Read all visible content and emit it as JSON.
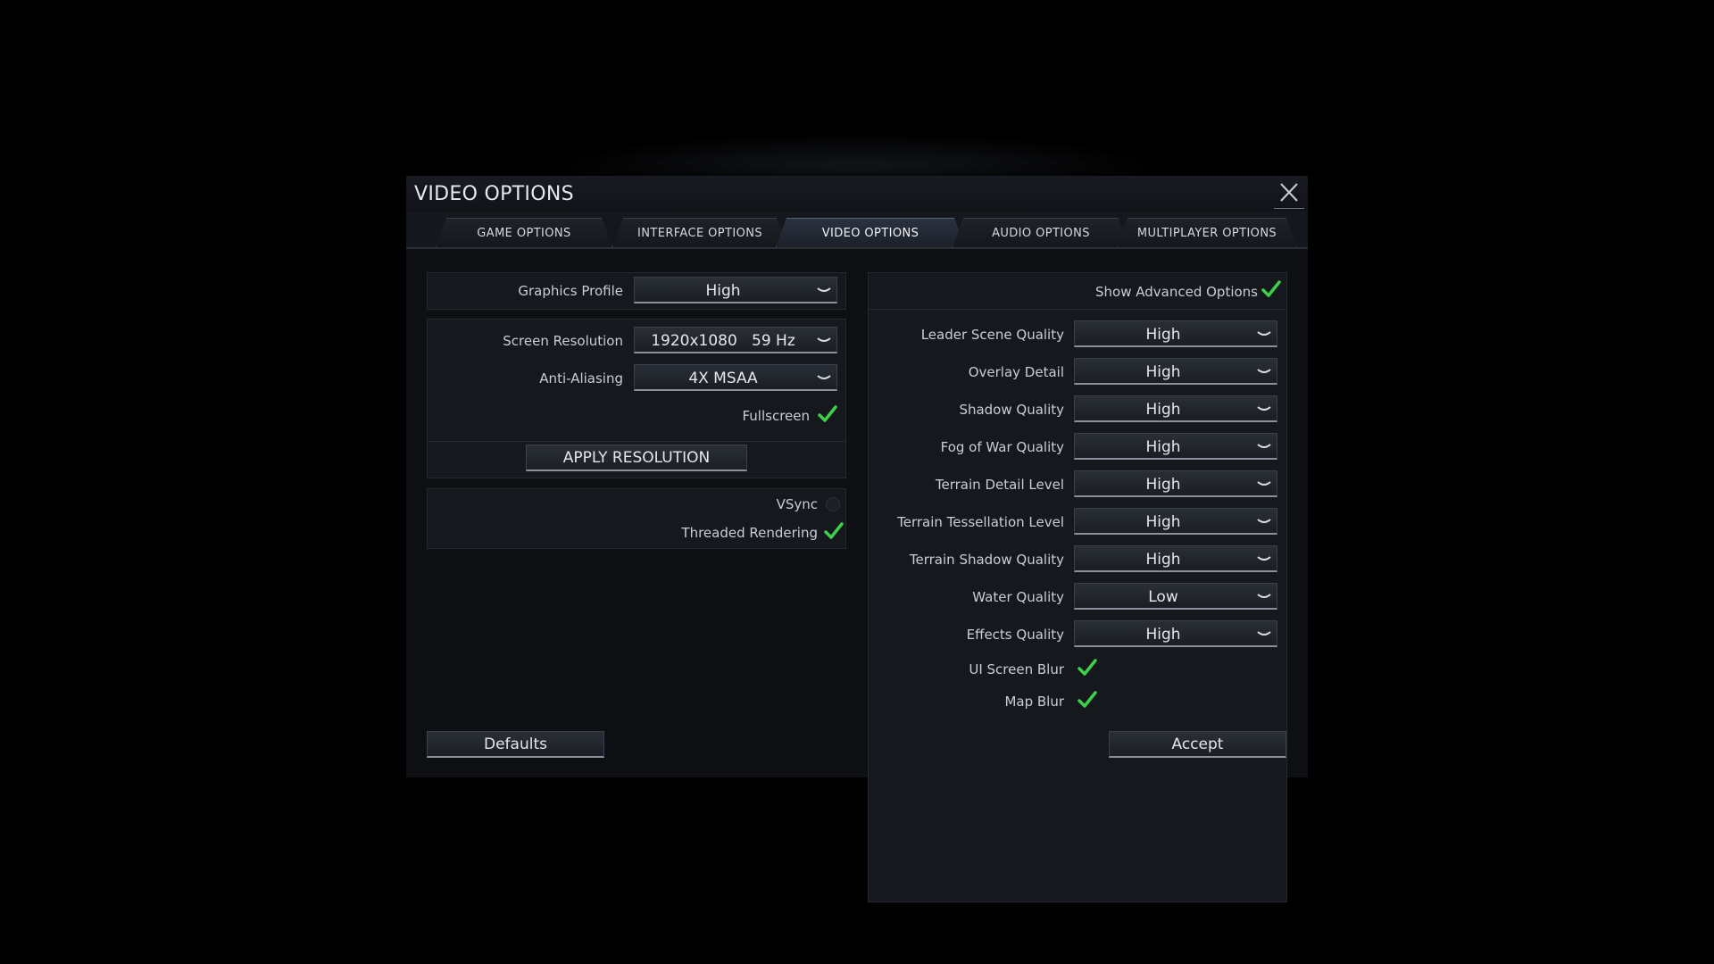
{
  "dialog": {
    "title": "VIDEO OPTIONS"
  },
  "tabs": [
    {
      "label": "GAME OPTIONS"
    },
    {
      "label": "INTERFACE OPTIONS"
    },
    {
      "label": "VIDEO OPTIONS",
      "active": true
    },
    {
      "label": "AUDIO OPTIONS"
    },
    {
      "label": "MULTIPLAYER OPTIONS"
    }
  ],
  "left": {
    "graphics_profile": {
      "label": "Graphics Profile",
      "value": "High"
    },
    "screen_resolution": {
      "label": "Screen Resolution",
      "value": "1920x1080   59 Hz"
    },
    "anti_aliasing": {
      "label": "Anti-Aliasing",
      "value": "4X MSAA"
    },
    "fullscreen": {
      "label": "Fullscreen",
      "checked": true
    },
    "apply_button": "APPLY RESOLUTION",
    "vsync": {
      "label": "VSync",
      "checked": false
    },
    "threaded_rendering": {
      "label": "Threaded Rendering",
      "checked": true
    }
  },
  "right": {
    "show_advanced": {
      "label": "Show Advanced Options",
      "checked": true
    },
    "settings": [
      {
        "label": "Leader Scene Quality",
        "value": "High"
      },
      {
        "label": "Overlay Detail",
        "value": "High"
      },
      {
        "label": "Shadow Quality",
        "value": "High"
      },
      {
        "label": "Fog of War Quality",
        "value": "High"
      },
      {
        "label": "Terrain Detail Level",
        "value": "High"
      },
      {
        "label": "Terrain Tessellation Level",
        "value": "High"
      },
      {
        "label": "Terrain Shadow Quality",
        "value": "High"
      },
      {
        "label": "Water Quality",
        "value": "Low"
      },
      {
        "label": "Effects Quality",
        "value": "High"
      }
    ],
    "ui_screen_blur": {
      "label": "UI Screen Blur",
      "checked": true
    },
    "map_blur": {
      "label": "Map Blur",
      "checked": true
    }
  },
  "footer": {
    "defaults": "Defaults",
    "accept": "Accept"
  },
  "colors": {
    "check": "#3fd04a",
    "accent_tab": "#56627a",
    "background": "#0d0f13"
  },
  "icons": {
    "close": "close-icon",
    "dropdown": "chevron-down-icon",
    "check": "checkmark-icon"
  }
}
